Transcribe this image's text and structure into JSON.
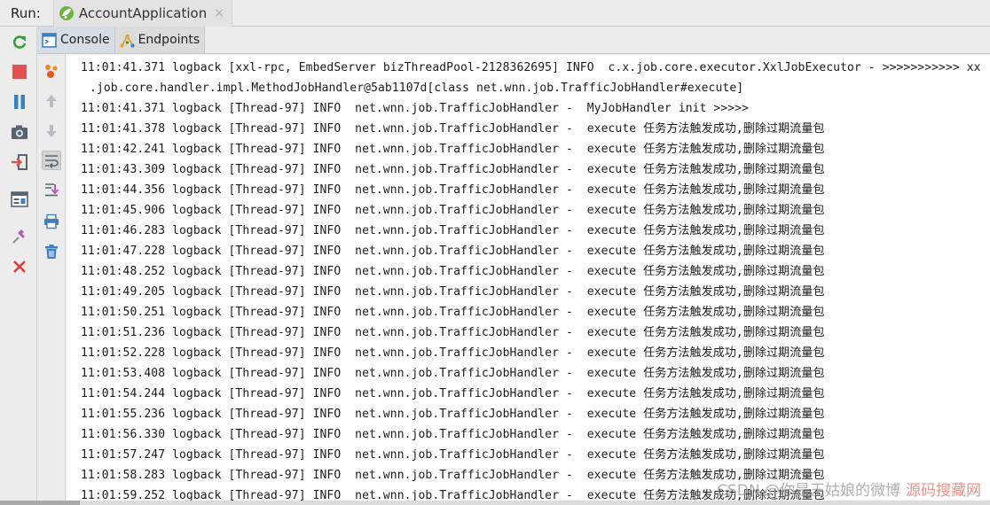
{
  "run": {
    "label": "Run:",
    "tab_title": "AccountApplication",
    "close_glyph": "×"
  },
  "subtabs": [
    {
      "label": "Console",
      "icon": "console-icon"
    },
    {
      "label": "Endpoints",
      "icon": "endpoints-icon"
    }
  ],
  "console_lines": [
    "11:01:41.371 logback [xxl-rpc, EmbedServer bizThreadPool-2128362695] INFO  c.x.job.core.executor.XxlJobExecutor - >>>>>>>>>>> xx",
    ".job.core.handler.impl.MethodJobHandler@5ab1107d[class net.wnn.job.TrafficJobHandler#execute]",
    "11:01:41.371 logback [Thread-97] INFO  net.wnn.job.TrafficJobHandler -  MyJobHandler init >>>>>",
    "11:01:41.378 logback [Thread-97] INFO  net.wnn.job.TrafficJobHandler -  execute 任务方法触发成功,删除过期流量包",
    "11:01:42.241 logback [Thread-97] INFO  net.wnn.job.TrafficJobHandler -  execute 任务方法触发成功,删除过期流量包",
    "11:01:43.309 logback [Thread-97] INFO  net.wnn.job.TrafficJobHandler -  execute 任务方法触发成功,删除过期流量包",
    "11:01:44.356 logback [Thread-97] INFO  net.wnn.job.TrafficJobHandler -  execute 任务方法触发成功,删除过期流量包",
    "11:01:45.906 logback [Thread-97] INFO  net.wnn.job.TrafficJobHandler -  execute 任务方法触发成功,删除过期流量包",
    "11:01:46.283 logback [Thread-97] INFO  net.wnn.job.TrafficJobHandler -  execute 任务方法触发成功,删除过期流量包",
    "11:01:47.228 logback [Thread-97] INFO  net.wnn.job.TrafficJobHandler -  execute 任务方法触发成功,删除过期流量包",
    "11:01:48.252 logback [Thread-97] INFO  net.wnn.job.TrafficJobHandler -  execute 任务方法触发成功,删除过期流量包",
    "11:01:49.205 logback [Thread-97] INFO  net.wnn.job.TrafficJobHandler -  execute 任务方法触发成功,删除过期流量包",
    "11:01:50.251 logback [Thread-97] INFO  net.wnn.job.TrafficJobHandler -  execute 任务方法触发成功,删除过期流量包",
    "11:01:51.236 logback [Thread-97] INFO  net.wnn.job.TrafficJobHandler -  execute 任务方法触发成功,删除过期流量包",
    "11:01:52.228 logback [Thread-97] INFO  net.wnn.job.TrafficJobHandler -  execute 任务方法触发成功,删除过期流量包",
    "11:01:53.408 logback [Thread-97] INFO  net.wnn.job.TrafficJobHandler -  execute 任务方法触发成功,删除过期流量包",
    "11:01:54.244 logback [Thread-97] INFO  net.wnn.job.TrafficJobHandler -  execute 任务方法触发成功,删除过期流量包",
    "11:01:55.236 logback [Thread-97] INFO  net.wnn.job.TrafficJobHandler -  execute 任务方法触发成功,删除过期流量包",
    "11:01:56.330 logback [Thread-97] INFO  net.wnn.job.TrafficJobHandler -  execute 任务方法触发成功,删除过期流量包",
    "11:01:57.247 logback [Thread-97] INFO  net.wnn.job.TrafficJobHandler -  execute 任务方法触发成功,删除过期流量包",
    "11:01:58.283 logback [Thread-97] INFO  net.wnn.job.TrafficJobHandler -  execute 任务方法触发成功,删除过期流量包",
    "11:01:59.252 logback [Thread-97] INFO  net.wnn.job.TrafficJobHandler -  execute 任务方法触发成功,删除过期流量包"
  ],
  "watermark": {
    "text": "CSDN @你是王姑娘的微博",
    "red_text": "源码搜藏网"
  },
  "colors": {
    "rerun_green": "#3a9a3a",
    "stop_red": "#e05252",
    "pause_blue": "#3c7fc0",
    "close_red": "#e03c3c",
    "spring_green": "#6db33f",
    "endpoints_orange": "#e8a23a"
  }
}
